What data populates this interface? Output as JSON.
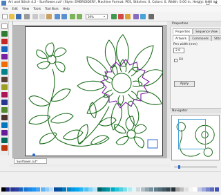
{
  "window": {
    "title": "Art and Stitch 4.2 - Sunflower.cut* (Style: EMBROIDERY, Machine Format: PES, Stitches: 0, Colors: 0, Width: 0.00 in, Height: 0.00 in)",
    "minimize": "–",
    "maximize": "□",
    "close": "✕"
  },
  "menu": [
    "File",
    "Edit",
    "View",
    "Tools",
    "Tool Bars",
    "Help"
  ],
  "toolbar": {
    "zoom": "39%",
    "zoom_arrow": "▾"
  },
  "properties": {
    "title": "Properties",
    "tabs_row1": [
      "Properties",
      "Sequence View"
    ],
    "tabs_row2": [
      "Artwork",
      "Commands",
      "Stitching"
    ],
    "pen_width_label": "Pen width (mm)",
    "pen_width_value": "2.0",
    "fill_label": "Fill",
    "apply_label": "Apply"
  },
  "navigator": {
    "title": "Navigator"
  },
  "document": {
    "tab_label": "Sunflower.cut*"
  },
  "colors": {
    "outline_green": "#1a6e1a",
    "stitch_purple": "#7a1fa2",
    "accent_blue": "#2a6ad0"
  }
}
